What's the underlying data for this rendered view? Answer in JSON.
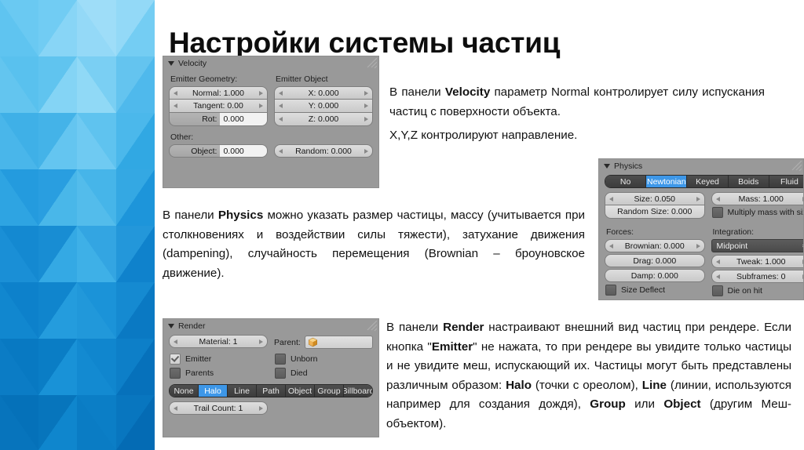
{
  "page": {
    "title": "Настройки системы частиц",
    "accent_blue": "#1f9fe0",
    "panel_gray": "#999999",
    "highlight_blue": "#3d97e8"
  },
  "velocity_panel": {
    "title": "Velocity",
    "emitter_geometry_label": "Emitter Geometry:",
    "emitter_object_label": "Emitter Object",
    "other_label": "Other:",
    "normal": {
      "label": "Normal:",
      "value": "1.000",
      "text": "Normal: 1.000"
    },
    "tangent": {
      "label": "Tangent:",
      "value": "0.00",
      "text": "Tangent: 0.00"
    },
    "rot": {
      "label": "Rot:",
      "value": "0.000"
    },
    "x": {
      "text": "X: 0.000"
    },
    "y": {
      "text": "Y: 0.000"
    },
    "z": {
      "text": "Z: 0.000"
    },
    "object": {
      "label": "Object:",
      "value": "0.000"
    },
    "random": {
      "text": "Random: 0.000"
    }
  },
  "physics_panel": {
    "title": "Physics",
    "tabs": [
      {
        "label": "No",
        "active": false
      },
      {
        "label": "Newtonian",
        "active": true
      },
      {
        "label": "Keyed",
        "active": false
      },
      {
        "label": "Boids",
        "active": false
      },
      {
        "label": "Fluid",
        "active": false
      }
    ],
    "size": {
      "text": "Size: 0.050"
    },
    "random_size": {
      "text": "Random Size: 0.000"
    },
    "mass": {
      "text": "Mass: 1.000"
    },
    "multiply_mass": {
      "label": "Multiply mass with siz",
      "checked": false
    },
    "forces_label": "Forces:",
    "integration_label": "Integration:",
    "brownian": {
      "text": "Brownian: 0.000"
    },
    "drag": {
      "text": "Drag: 0.000"
    },
    "damp": {
      "text": "Damp: 0.000"
    },
    "integration_value": "Midpoint",
    "tweak": {
      "text": "Tweak: 1.000"
    },
    "subframes": {
      "text": "Subframes: 0"
    },
    "size_deflect": {
      "label": "Size Deflect",
      "checked": false
    },
    "die_on_hit": {
      "label": "Die on hit",
      "checked": false
    }
  },
  "render_panel": {
    "title": "Render",
    "material": {
      "text": "Material: 1"
    },
    "parent_label": "Parent:",
    "parent_value": "",
    "emitter": {
      "label": "Emitter",
      "checked": true
    },
    "parents": {
      "label": "Parents",
      "checked": false
    },
    "unborn": {
      "label": "Unborn",
      "checked": false
    },
    "died": {
      "label": "Died",
      "checked": false
    },
    "modes": [
      {
        "label": "None",
        "active": false
      },
      {
        "label": "Halo",
        "active": true
      },
      {
        "label": "Line",
        "active": false
      },
      {
        "label": "Path",
        "active": false
      },
      {
        "label": "Object",
        "active": false
      },
      {
        "label": "Group",
        "active": false
      },
      {
        "label": "Billboard",
        "active": false
      }
    ],
    "trail_count": {
      "text": "Trail Count: 1"
    }
  },
  "paragraphs": {
    "velocity": {
      "line1_a": "В панели ",
      "line1_b": "Velocity",
      "line1_c": " параметр Normal контролирует силу испускания частиц с поверхности объекта.",
      "line2": "X,Y,Z контролируют направление."
    },
    "physics": {
      "a": "В панели ",
      "b": "Physics",
      "c": " можно указать размер частицы, массу (учитывается при столкновениях и воздействии силы тяжести),  затухание движения (dampening), случайность перемещения (Brownian – броуновское движение)."
    },
    "render": {
      "a": "В панели ",
      "b": "Render",
      "c": " настраивают внешний вид частиц при рендере. Если кнопка \"",
      "d": "Emitter",
      "e": "\" не нажата, то при рендере вы увидите только частицы и не увидите меш, испускающий их. Частицы могут быть представлены различным образом: ",
      "f": "Halo",
      "g": " (точки с ореолом), ",
      "h": "Line",
      "i": " (линии, используются например для создания дождя), ",
      "j": "Group",
      "k": " или ",
      "l": "Object",
      "m": " (другим Меш-объектом)."
    }
  }
}
